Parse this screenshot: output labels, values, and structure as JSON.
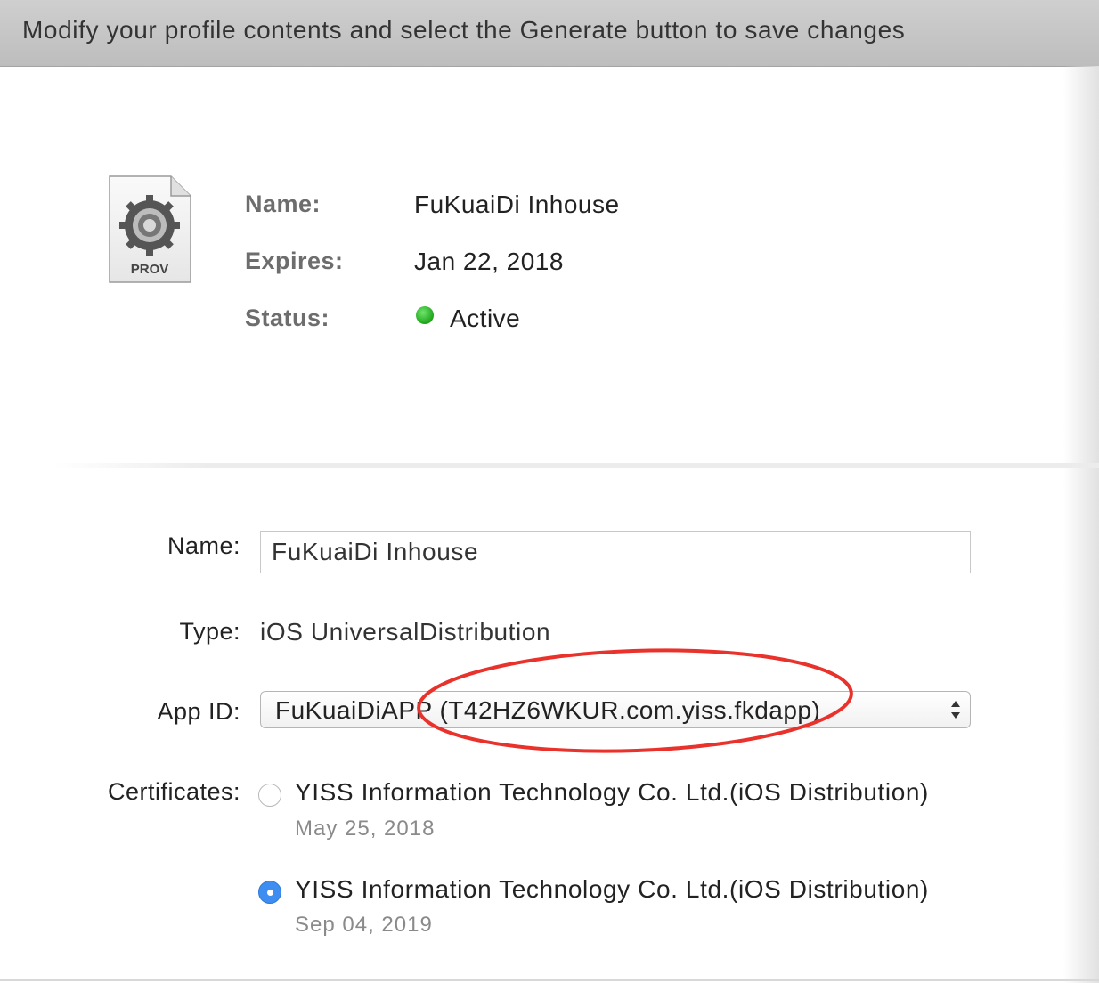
{
  "header": {
    "text": "Modify your profile contents and select the Generate button to save changes"
  },
  "summary": {
    "icon_label": "PROV",
    "name_label": "Name:",
    "name_value": "FuKuaiDi Inhouse",
    "expires_label": "Expires:",
    "expires_value": "Jan 22, 2018",
    "status_label": "Status:",
    "status_value": "Active",
    "status_color": "#2db52a"
  },
  "form": {
    "name_label": "Name:",
    "name_value": "FuKuaiDi Inhouse",
    "type_label": "Type:",
    "type_value": "iOS UniversalDistribution",
    "appid_label": "App ID:",
    "appid_value": "FuKuaiDiAPP (T42HZ6WKUR.com.yiss.fkdapp)",
    "certificates_label": "Certificates:",
    "certificates": [
      {
        "name": "YISS Information Technology Co. Ltd.(iOS Distribution)",
        "date": "May 25, 2018",
        "selected": false
      },
      {
        "name": "YISS Information Technology Co. Ltd.(iOS Distribution)",
        "date": "Sep 04, 2019",
        "selected": true
      }
    ]
  },
  "colors": {
    "accent": "#3d8ef0",
    "annotation": "#e8322b"
  }
}
